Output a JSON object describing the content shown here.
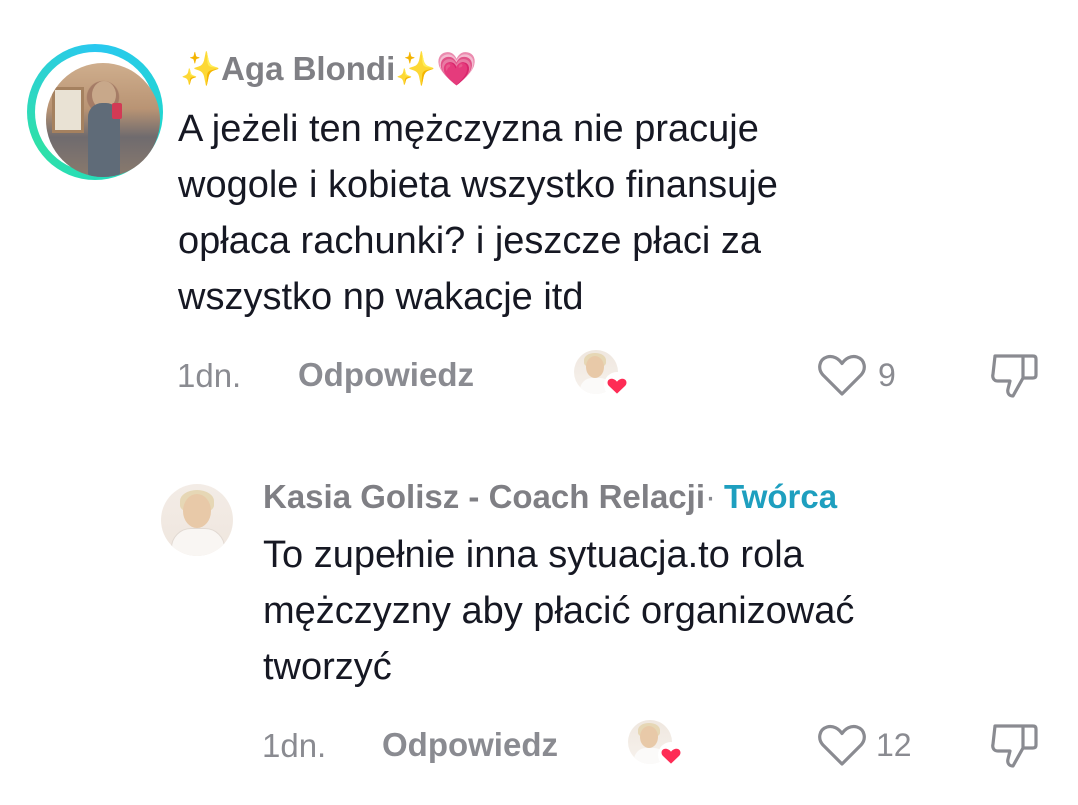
{
  "comments": [
    {
      "username_prefix": "✨",
      "username": "Aga Blondi",
      "username_suffix": "✨💗",
      "text_lines": [
        "A jeżeli ten mężczyzna nie pracuje",
        "wogole i kobieta wszystko finansuje",
        "opłaca rachunki? i jeszcze płaci za",
        "wszystko np wakacje itd"
      ],
      "time": "1dn.",
      "reply_label": "Odpowiedz",
      "likes": "9"
    },
    {
      "username": "Kasia Golisz - Coach Relacji",
      "separator": "·",
      "badge": "Twórca",
      "text_lines": [
        "To zupełnie inna sytuacja.to rola",
        "mężczyzny aby płacić organizować",
        "tworzyć"
      ],
      "time": "1dn.",
      "reply_label": "Odpowiedz",
      "likes": "12"
    }
  ],
  "colors": {
    "text": "#161823",
    "muted": "#8a8b91",
    "creator_badge": "#1e9fbf",
    "heart": "#fe2c55",
    "story_ring": "#29c8f0"
  },
  "icons": [
    "heart-outline-icon",
    "thumbs-down-icon",
    "creator-liked-heart-icon"
  ]
}
